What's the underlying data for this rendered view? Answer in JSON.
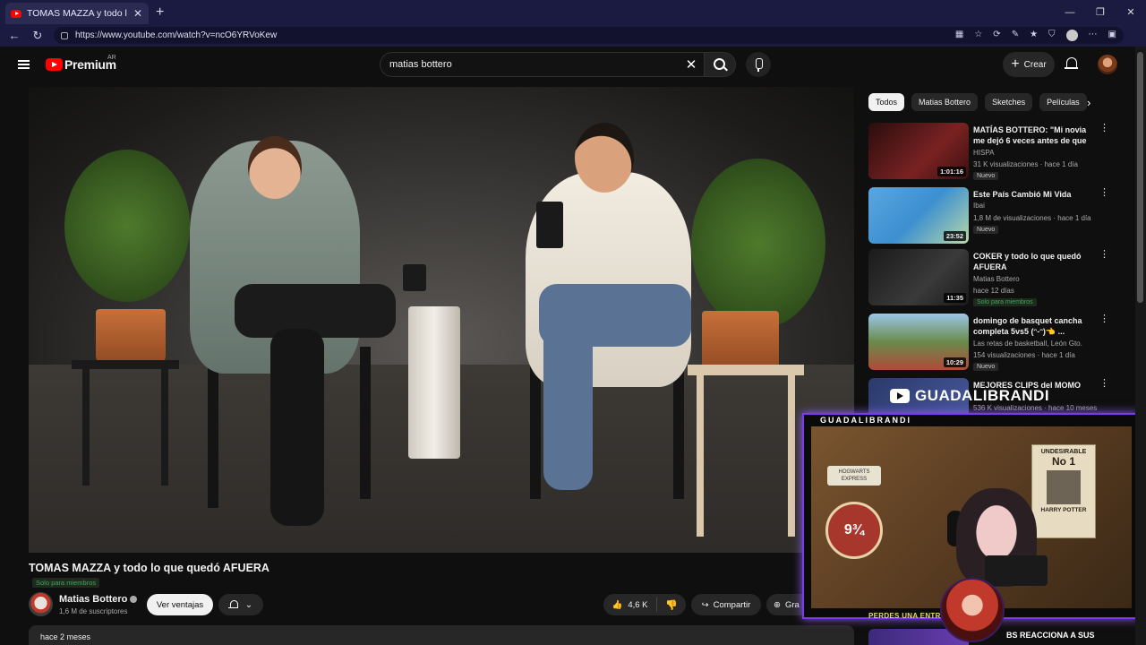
{
  "browser": {
    "tab_title": "TOMAS MAZZA y todo lo que quedó AFUERA",
    "url": "https://www.youtube.com/watch?v=ncO6YRVoKew"
  },
  "header": {
    "brand": "Premium",
    "region": "AR",
    "search_value": "matias bottero",
    "create_label": "Crear"
  },
  "video": {
    "title": "TOMAS MAZZA y todo lo que quedó AFUERA",
    "member_badge": "Solo para miembros",
    "channel": "Matias Bottero",
    "subscribers": "1,6 M de suscriptores",
    "sales_label": "Ver ventajas",
    "likes": "4,6 K",
    "share_label": "Compartir",
    "save_label": "Gra",
    "date": "hace 2 meses"
  },
  "chips": [
    "Todos",
    "Matias Bottero",
    "Sketches",
    "Películas"
  ],
  "recommendations": [
    {
      "title": "MATÍAS BOTTERO: \"Mi novia me dejó 6 veces antes de que ...",
      "channel": "HISPA",
      "meta": "31 K visualizaciones · hace 1 día",
      "duration": "1:01:16",
      "badge": "Nuevo",
      "color": "#5a1a1a"
    },
    {
      "title": "Este País Cambió Mi Vida",
      "channel": "Ibai",
      "meta": "1,8 M de visualizaciones · hace 1 día",
      "duration": "23:52",
      "badge": "Nuevo",
      "color": "#3c8fd0"
    },
    {
      "title": "COKER y todo lo que quedó AFUERA",
      "channel": "Matias Bottero",
      "meta": "hace 12 días",
      "duration": "11:35",
      "badge": "Solo para miembros",
      "color": "#2b2b2b"
    },
    {
      "title": "domingo de basquet cancha completa 5vs5 (ᵔ-ᵔ)👈 ...",
      "channel": "Las retas de basketball, León Gto.",
      "meta": "154 visualizaciones · hace 1 día",
      "duration": "10:29",
      "badge": "Nuevo",
      "color": "#6a8a4a"
    },
    {
      "title": "MEJORES CLIPS del MOMO",
      "channel": "",
      "meta": "536 K visualizaciones · hace 10 meses",
      "duration": "",
      "badge": "",
      "color": "#2a3a6a"
    }
  ],
  "overlay": {
    "banner_name": "GUADALIBRANDI",
    "cam_label": "GUADALIBRANDI",
    "poster_header": "UNDESIRABLE",
    "poster_number": "No 1",
    "poster_footer": "HARRY POTTER",
    "platform": "9¾",
    "hogwarts": "HOGWARTS EXPRESS",
    "caption": "PERDES UNA ENTRADA",
    "last_rec_title": "BS REACCIONA A SUS"
  }
}
